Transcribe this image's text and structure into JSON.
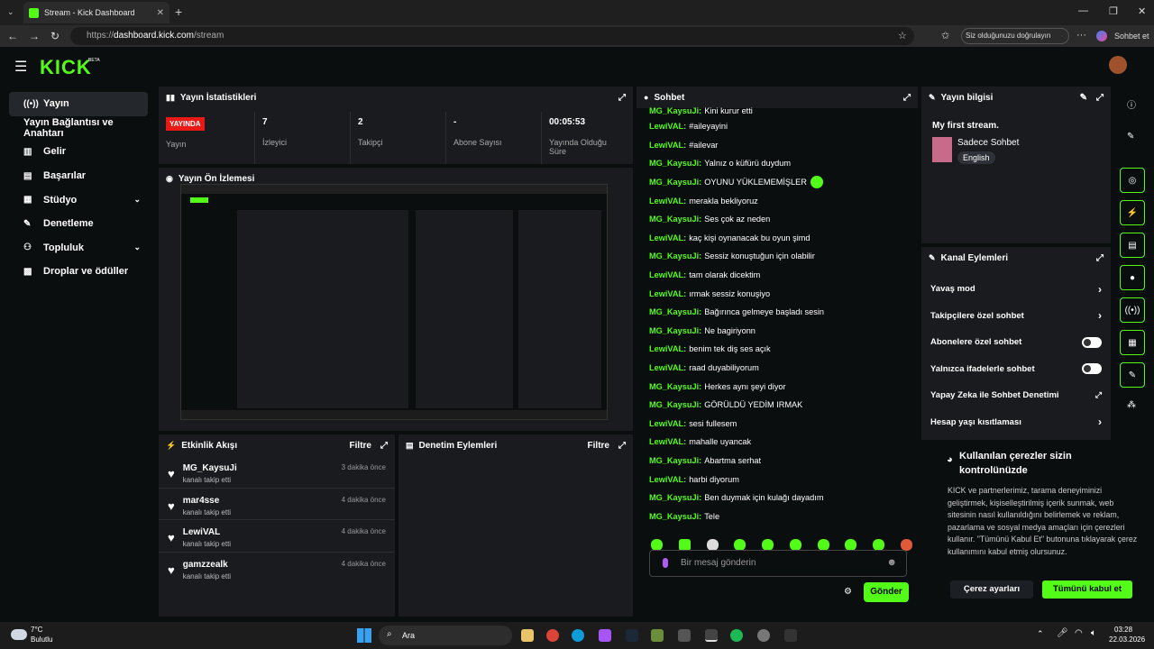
{
  "browser": {
    "tab_title": "Stream - Kick Dashboard",
    "url_prefix": "https://",
    "url_domain": "dashboard.kick.com",
    "url_path": "/stream",
    "verify_label": "Siz olduğunuzu doğrulayın",
    "copilot_label": "Sohbet et"
  },
  "header": {
    "logo": "KICK",
    "logo_badge": "BETA"
  },
  "sidebar": {
    "items": [
      {
        "label": "Yayın",
        "icon": "broadcast-icon"
      },
      {
        "label": "Yayın Bağlantısı ve Anahtarı",
        "icon": ""
      },
      {
        "label": "Gelir",
        "icon": "chart-icon"
      },
      {
        "label": "Başarılar",
        "icon": "trophy-icon"
      },
      {
        "label": "Stüdyo",
        "icon": "grid-icon"
      },
      {
        "label": "Denetleme",
        "icon": "wrench-icon"
      },
      {
        "label": "Topluluk",
        "icon": "community-icon"
      },
      {
        "label": "Droplar ve ödüller",
        "icon": "gift-icon"
      }
    ]
  },
  "stats": {
    "title": "Yayın İstatistikleri",
    "live_badge": "YAYINDA",
    "items": [
      {
        "value": "",
        "label": "Yayın"
      },
      {
        "value": "7",
        "label": "İzleyici"
      },
      {
        "value": "2",
        "label": "Takipçi"
      },
      {
        "value": "-",
        "label": "Abone Sayısı"
      },
      {
        "value": "00:05:53",
        "label": "Yayında Olduğu Süre"
      }
    ]
  },
  "preview": {
    "title": "Yayın Ön İzlemesi"
  },
  "activity": {
    "title": "Etkinlik Akışı",
    "filter": "Filtre",
    "items": [
      {
        "name": "MG_KaysuJi",
        "sub": "kanalı takip etti",
        "time": "3 dakika önce"
      },
      {
        "name": "mar4sse",
        "sub": "kanalı takip etti",
        "time": "4 dakika önce"
      },
      {
        "name": "LewiVAL",
        "sub": "kanalı takip etti",
        "time": "4 dakika önce"
      },
      {
        "name": "gamzzealk",
        "sub": "kanalı takip etti",
        "time": "4 dakika önce"
      }
    ]
  },
  "moderation": {
    "title": "Denetim Eylemleri",
    "filter": "Filtre"
  },
  "chat": {
    "title": "Sohbet",
    "messages": [
      {
        "user": "MG_KaysuJi:",
        "text": "Kini kurur etti"
      },
      {
        "user": "LewiVAL:",
        "text": "#aileyayini"
      },
      {
        "user": "LewiVAL:",
        "text": "#ailevar"
      },
      {
        "user": "MG_KaysuJi:",
        "text": "Yalnız o küfürü duydum"
      },
      {
        "user": "MG_KaysuJi:",
        "text": "OYUNU YÜKLEMEMİŞLER"
      },
      {
        "user": "LewiVAL:",
        "text": "merakla bekliyoruz"
      },
      {
        "user": "MG_KaysuJi:",
        "text": "Ses çok az neden"
      },
      {
        "user": "LewiVAL:",
        "text": "kaç kişi oynanacak bu oyun şimd"
      },
      {
        "user": "MG_KaysuJi:",
        "text": "Sessiz konuştuğun için olabilir"
      },
      {
        "user": "LewiVAL:",
        "text": "tam olarak dicektim"
      },
      {
        "user": "LewiVAL:",
        "text": "ırmak sessiz konuşiyo"
      },
      {
        "user": "MG_KaysuJi:",
        "text": "Bağırınca gelmeye başladı sesin"
      },
      {
        "user": "MG_KaysuJi:",
        "text": "Ne bagiriyonn"
      },
      {
        "user": "LewiVAL:",
        "text": "benim tek diş ses açık"
      },
      {
        "user": "LewiVAL:",
        "text": "raad duyabiliyorum"
      },
      {
        "user": "MG_KaysuJi:",
        "text": "Herkes aynı şeyi diyor"
      },
      {
        "user": "MG_KaysuJi:",
        "text": "GÖRÜLDÜ YEDİM IRMAK"
      },
      {
        "user": "LewiVAL:",
        "text": "sesi fullesem"
      },
      {
        "user": "LewiVAL:",
        "text": "mahalle uyancak"
      },
      {
        "user": "MG_KaysuJi:",
        "text": "Abartma serhat"
      },
      {
        "user": "LewiVAL:",
        "text": "harbi diyorum"
      },
      {
        "user": "MG_KaysuJi:",
        "text": "Ben duymak için kulağı dayadım"
      },
      {
        "user": "MG_KaysuJi:",
        "text": "Tele"
      }
    ],
    "placeholder": "Bir mesaj gönderin",
    "send_label": "Gönder"
  },
  "stream_info": {
    "title": "Yayın bilgisi",
    "stream_title": "My first stream.",
    "category": "Sadece Sohbet",
    "language": "English"
  },
  "channel_actions": {
    "title": "Kanal Eylemleri",
    "rows": [
      {
        "label": "Yavaş mod",
        "control": "chevron"
      },
      {
        "label": "Takipçilere özel sohbet",
        "control": "chevron"
      },
      {
        "label": "Abonelere özel sohbet",
        "control": "toggle"
      },
      {
        "label": "Yalnızca ifadelerle sohbet",
        "control": "toggle"
      },
      {
        "label": "Yapay Zeka ile Sohbet Denetimi",
        "control": "external"
      },
      {
        "label": "Hesap yaşı kısıtlaması",
        "control": "chevron"
      }
    ]
  },
  "cookie": {
    "title": "Kullanılan çerezler sizin kontrolünüzde",
    "body": "KICK ve partnerlerimiz, tarama deneyiminizi geliştirmek, kişiselleştirilmiş içerik sunmak, web sitesinin nasıl kullanıldığını belirlemek ve reklam, pazarlama ve sosyal medya amaçları için çerezleri kullanır. \"Tümünü Kabul Et\" butonuna tıklayarak çerez kullanımını kabul etmiş olursunuz.",
    "settings_label": "Çerez ayarları",
    "accept_label": "Tümünü kabul et"
  },
  "taskbar": {
    "temp": "7°C",
    "weather": "Bulutlu",
    "search": "Ara",
    "time": "03:28",
    "date": "22.03.2026"
  }
}
